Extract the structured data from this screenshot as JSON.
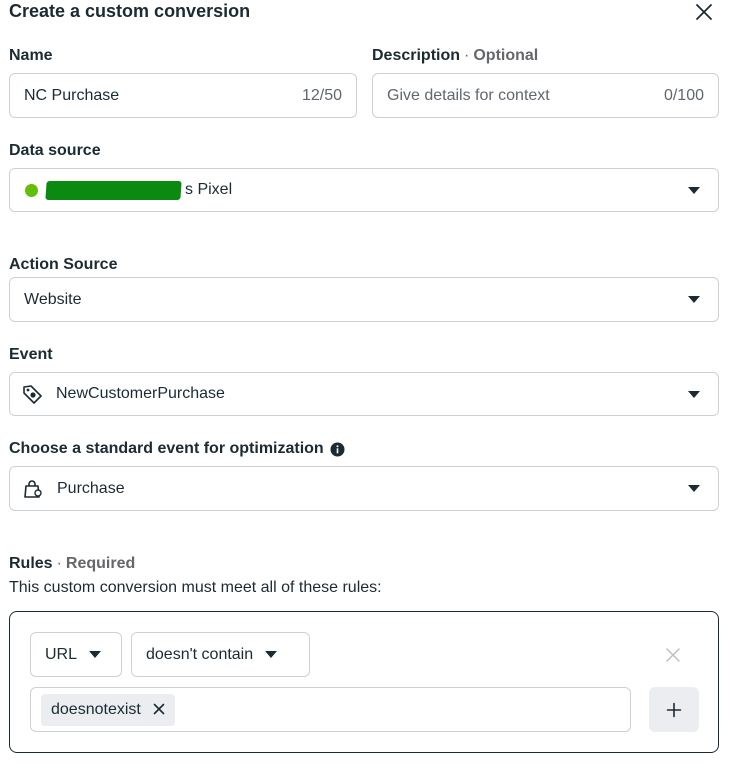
{
  "dialog": {
    "title": "Create a custom conversion"
  },
  "name": {
    "label": "Name",
    "value": "NC Purchase",
    "counter": "12/50"
  },
  "description": {
    "label": "Description",
    "optional": "Optional",
    "placeholder": "Give details for context",
    "counter": "0/100"
  },
  "data_source": {
    "label": "Data source",
    "status_color": "#63be09",
    "value_suffix": "s Pixel",
    "redacted": true
  },
  "action_source": {
    "label": "Action Source",
    "value": "Website"
  },
  "event": {
    "label": "Event",
    "icon": "tag-icon",
    "value": "NewCustomerPurchase"
  },
  "standard_event": {
    "label": "Choose a standard event for optimization",
    "info_icon": "info-icon",
    "icon": "shopping-bag-icon",
    "value": "Purchase"
  },
  "rules": {
    "label": "Rules",
    "required": "Required",
    "description": "This custom conversion must meet all of these rules:",
    "rule": {
      "field": "URL",
      "operator": "doesn't contain",
      "tokens": [
        "doesnotexist"
      ]
    }
  }
}
